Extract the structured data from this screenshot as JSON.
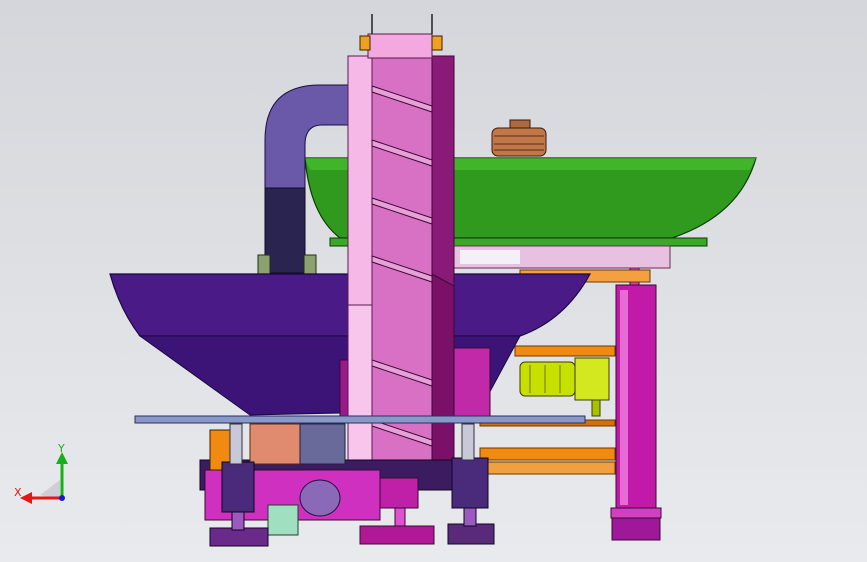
{
  "viewport": {
    "background": "#d9dbe0",
    "triad": {
      "x_label": "X",
      "y_label": "Y",
      "x_color": "#e01818",
      "y_color": "#18b018",
      "z_color": "#1818d0"
    }
  },
  "model": {
    "description_icons": [
      "hopper-bowl",
      "spiral-elevator",
      "vibration-bowl",
      "support-legs",
      "motor"
    ],
    "colors": {
      "green_bowl": "#2f9a1e",
      "purple_hopper": "#4a1a86",
      "pink_column": "#f0a8e0",
      "magenta_column": "#b01ca8",
      "orange_frame": "#f08a10",
      "yellow_motor": "#c8e000",
      "steel_plate": "#8a98c8"
    }
  }
}
